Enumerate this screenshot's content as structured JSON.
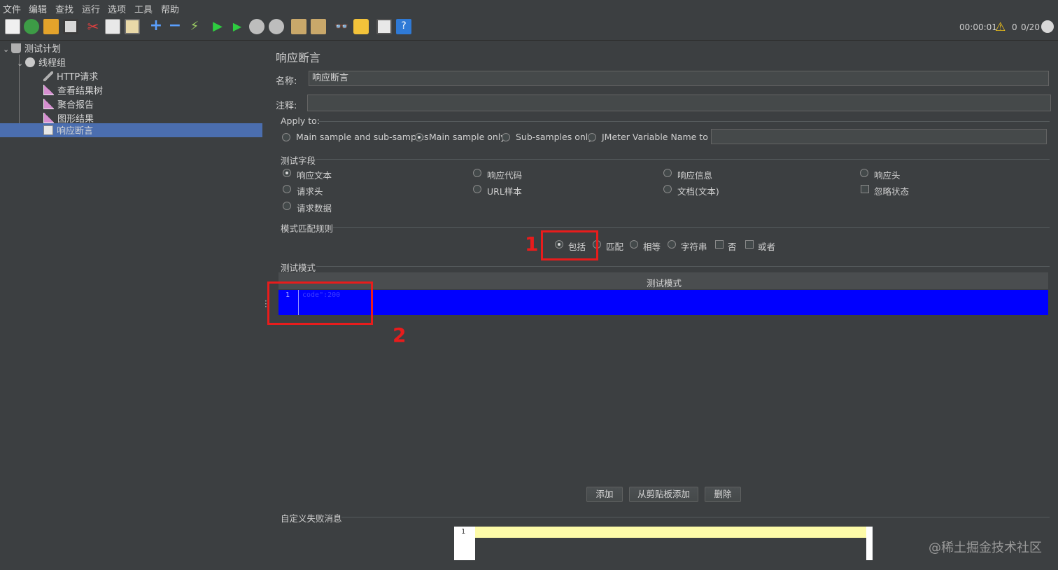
{
  "menubar": {
    "items": [
      "文件",
      "编辑",
      "查找",
      "运行",
      "选项",
      "工具",
      "帮助"
    ]
  },
  "toolbar": {
    "icons": [
      "new-icon",
      "templates-icon",
      "open-icon",
      "save-icon",
      "cut-icon",
      "copy-icon",
      "paste-icon",
      "expand-icon",
      "collapse-icon",
      "toggle-icon",
      "start-icon",
      "start-no-pause-icon",
      "stop-icon",
      "shutdown-icon",
      "clear-icon",
      "clear-all-icon",
      "search-icon",
      "reset-search-icon",
      "function-helper-icon",
      "help-icon"
    ],
    "elapsed": "00:00:01",
    "warnings": "0",
    "threads": "0/20"
  },
  "tree": {
    "nodes": [
      {
        "label": "测试计划",
        "icon": "test-plan-icon"
      },
      {
        "label": "线程组",
        "icon": "thread-group-gear-icon"
      },
      {
        "label": "HTTP请求",
        "icon": "http-request-pen-icon"
      },
      {
        "label": "查看结果树",
        "icon": "chart-listener-icon"
      },
      {
        "label": "聚合报告",
        "icon": "chart-listener-icon"
      },
      {
        "label": "图形结果",
        "icon": "chart-listener-icon"
      },
      {
        "label": "响应断言",
        "icon": "assertion-icon"
      }
    ]
  },
  "editor": {
    "title": "响应断言",
    "name_label": "名称:",
    "name_value": "响应断言",
    "comment_label": "注释:",
    "comment_value": "",
    "apply_to": {
      "label": "Apply to:",
      "options": [
        "Main sample and sub-samples",
        "Main sample only",
        "Sub-samples only",
        "JMeter Variable Name to use"
      ],
      "selected": "Main sample only",
      "variable_value": ""
    },
    "field_to_test": {
      "label": "测试字段",
      "radios": [
        "响应文本",
        "响应代码",
        "响应信息",
        "响应头",
        "请求头",
        "URL样本",
        "文档(文本)",
        "请求数据"
      ],
      "checkbox": "忽略状态",
      "selected": "响应文本"
    },
    "pattern_rules": {
      "label": "模式匹配规则",
      "radios": [
        "包括",
        "匹配",
        "相等",
        "字符串"
      ],
      "checkboxes": [
        "否",
        "或者"
      ],
      "selected": "包括"
    },
    "patterns": {
      "label": "测试模式",
      "column_header": "测试模式",
      "rows": [
        {
          "line": "1",
          "text": "code\":200"
        }
      ]
    },
    "buttons": {
      "add": "添加",
      "add_from_clipboard": "从剪贴板添加",
      "delete": "删除"
    },
    "custom_failure": {
      "label": "自定义失败消息",
      "line": "1",
      "value": ""
    }
  },
  "annotations": {
    "mark1": "1",
    "mark2": "2"
  },
  "watermark": "@稀土掘金技术社区",
  "colors": {
    "selection": "#4b6eaf",
    "pattern_row": "#0000ff",
    "annotation": "#e81c1c",
    "editor_highlight": "#fdfba8"
  }
}
